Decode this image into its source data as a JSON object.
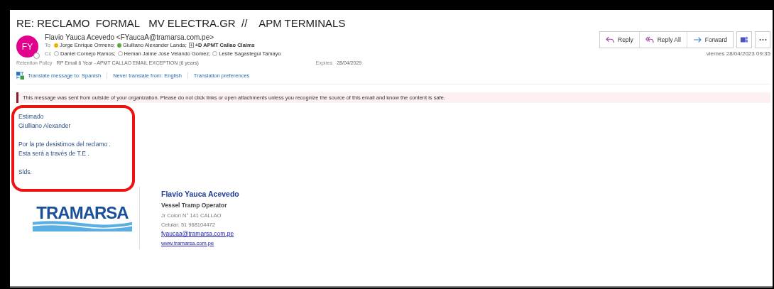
{
  "subject": "RE: RECLAMO  FORMAL   MV ELECTRA.GR  //    APM TERMINALS",
  "sender": {
    "initials": "FY",
    "name": "Flavio Yauca Acevedo <FYaucaA@tramarsa.com.pe>"
  },
  "to": {
    "label": "To",
    "recipients": [
      {
        "name": "Jorge Enrique Ormeno;",
        "kind": "person",
        "color": "#e8b400"
      },
      {
        "name": "Giulliano Alexander Landa;",
        "kind": "person",
        "color": "#58a83b"
      },
      {
        "name": "+D APMT Callao Claims",
        "kind": "group"
      }
    ]
  },
  "cc": {
    "label": "Cc",
    "recipients": [
      {
        "name": "Daniel Cornejo Ramos;",
        "kind": "unknown"
      },
      {
        "name": "Heman Jaime Jose Velando Gomez;",
        "kind": "unknown"
      },
      {
        "name": "Leslie Sagastegui Tamayo",
        "kind": "unknown"
      }
    ]
  },
  "retention": {
    "label": "Retention Policy",
    "value": "RP Email 6 Year - APMT CALLAO EMAIL EXCEPTION (6 years)",
    "expires_label": "Expires",
    "expires": "28/04/2029"
  },
  "actions": [
    {
      "label": "Reply",
      "kind": "reply"
    },
    {
      "label": "Reply All",
      "kind": "reply-all"
    },
    {
      "label": "Forward",
      "kind": "forward"
    }
  ],
  "date": "viernes 28/04/2023 09:35",
  "translate_links": [
    "Translate message to: Spanish",
    "Never translate from: English",
    "Translation preferences"
  ],
  "warning": "This message was sent from outside of your organization. Please do not click links or open attachments unless you recognize the source of this email and know the content is safe.",
  "body": [
    [
      "Estimado",
      "Giulliano Alexander"
    ],
    [
      "Por la pte desistimos del reclamo .",
      "Esta será a través de T.E ."
    ],
    [
      "Slds."
    ]
  ],
  "signature": {
    "logo": "TRAMARSA",
    "name": "Flavio Yauca Acevedo",
    "title": "Vessel Tramp Operator",
    "address": "Jr Colon N° 141   CALLAO",
    "phone": "Celular:  51 968104472",
    "email": "fyaucaa@tramarsa.com.pe",
    "web": "www.tramarsa.com.pe"
  }
}
